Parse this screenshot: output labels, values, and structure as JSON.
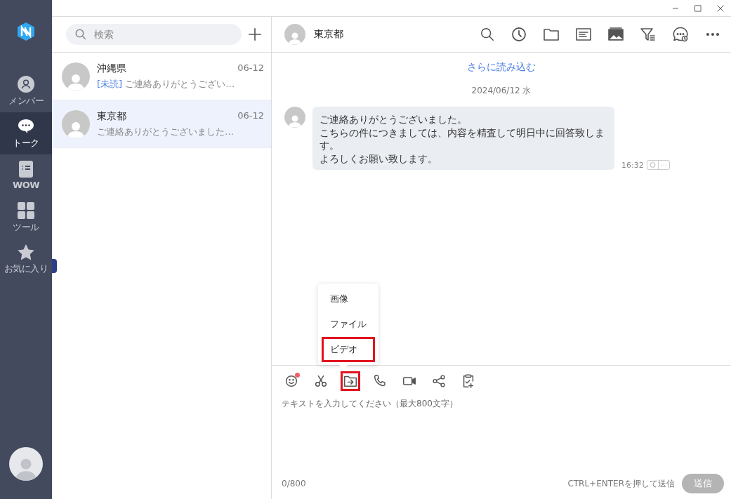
{
  "sidebar": {
    "items": [
      {
        "label": "メンバー",
        "selected": false
      },
      {
        "label": "トーク",
        "selected": true
      },
      {
        "label": "WOW",
        "selected": false
      },
      {
        "label": "ツール",
        "selected": false
      },
      {
        "label": "お気に入り",
        "selected": false
      }
    ]
  },
  "search": {
    "placeholder": "検索"
  },
  "conversations": [
    {
      "name": "沖縄県",
      "date": "06-12",
      "unread_tag": "[未読]",
      "preview": "ご連絡ありがとうござい…",
      "selected": false
    },
    {
      "name": "東京都",
      "date": "06-12",
      "preview": "ご連絡ありがとうございました…",
      "selected": true
    }
  ],
  "chat": {
    "title": "東京都",
    "load_more": "さらに読み込む",
    "date_divider": "2024/06/12 水",
    "messages": [
      {
        "lines": [
          "ご連絡ありがとうございました。",
          "こちらの件につきましては、内容を精査して明日中に回答致します。",
          "よろしくお願い致します。"
        ],
        "time": "16:32"
      }
    ]
  },
  "attach_menu": {
    "items": [
      {
        "label": "画像",
        "highlighted": false
      },
      {
        "label": "ファイル",
        "highlighted": false
      },
      {
        "label": "ビデオ",
        "highlighted": true
      }
    ]
  },
  "toolbar": {
    "tools": [
      {
        "kind": "emoji",
        "badge": true,
        "highlighted": false
      },
      {
        "kind": "scissors",
        "badge": false,
        "highlighted": false
      },
      {
        "kind": "attach",
        "badge": false,
        "highlighted": true
      },
      {
        "kind": "phone",
        "badge": false,
        "highlighted": false
      },
      {
        "kind": "video",
        "badge": false,
        "highlighted": false
      },
      {
        "kind": "share",
        "badge": false,
        "highlighted": false
      },
      {
        "kind": "clipboard",
        "badge": false,
        "highlighted": false
      }
    ]
  },
  "composer": {
    "placeholder": "テキストを入力してください（最大800文字）",
    "counter": "0/800",
    "hint": "CTRL+ENTERを押して送信",
    "send": {
      "label": "送信",
      "disabled": true
    }
  }
}
